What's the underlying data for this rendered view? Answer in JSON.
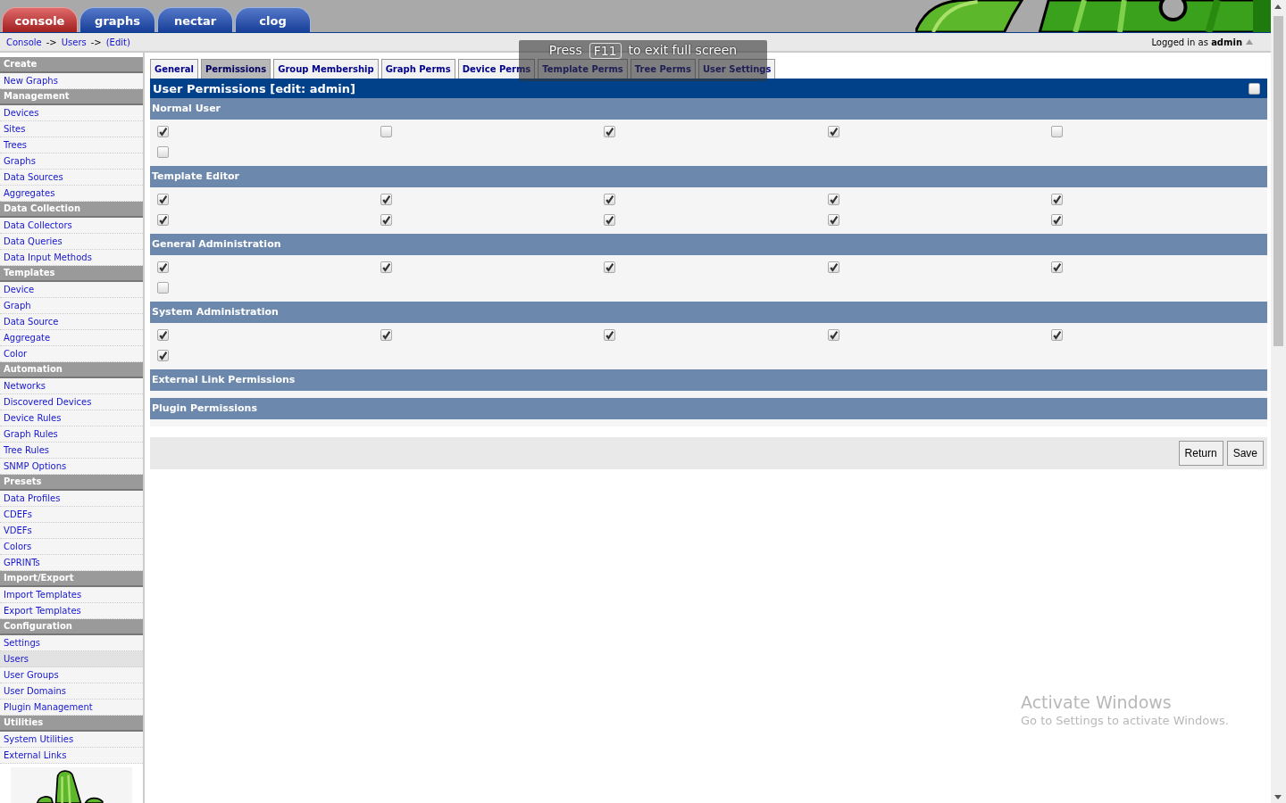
{
  "top_tabs": [
    {
      "label": "console",
      "selected": true
    },
    {
      "label": "graphs",
      "selected": false
    },
    {
      "label": "nectar",
      "selected": false
    },
    {
      "label": "clog",
      "selected": false
    }
  ],
  "breadcrumb": [
    {
      "label": "Console"
    },
    {
      "label": "Users"
    },
    {
      "label": "(Edit)"
    }
  ],
  "breadcrumb_separator": "->",
  "login": {
    "prefix": "Logged in as",
    "user": "admin"
  },
  "sidebar": [
    {
      "kind": "header",
      "label": "Create"
    },
    {
      "kind": "link",
      "label": "New Graphs",
      "selected": false
    },
    {
      "kind": "header",
      "label": "Management"
    },
    {
      "kind": "link",
      "label": "Devices",
      "selected": false
    },
    {
      "kind": "link",
      "label": "Sites",
      "selected": false
    },
    {
      "kind": "link",
      "label": "Trees",
      "selected": false
    },
    {
      "kind": "link",
      "label": "Graphs",
      "selected": false
    },
    {
      "kind": "link",
      "label": "Data Sources",
      "selected": false
    },
    {
      "kind": "link",
      "label": "Aggregates",
      "selected": false
    },
    {
      "kind": "header",
      "label": "Data Collection"
    },
    {
      "kind": "link",
      "label": "Data Collectors",
      "selected": false
    },
    {
      "kind": "link",
      "label": "Data Queries",
      "selected": false
    },
    {
      "kind": "link",
      "label": "Data Input Methods",
      "selected": false
    },
    {
      "kind": "header",
      "label": "Templates"
    },
    {
      "kind": "link",
      "label": "Device",
      "selected": false
    },
    {
      "kind": "link",
      "label": "Graph",
      "selected": false
    },
    {
      "kind": "link",
      "label": "Data Source",
      "selected": false
    },
    {
      "kind": "link",
      "label": "Aggregate",
      "selected": false
    },
    {
      "kind": "link",
      "label": "Color",
      "selected": false
    },
    {
      "kind": "header",
      "label": "Automation"
    },
    {
      "kind": "link",
      "label": "Networks",
      "selected": false
    },
    {
      "kind": "link",
      "label": "Discovered Devices",
      "selected": false
    },
    {
      "kind": "link",
      "label": "Device Rules",
      "selected": false
    },
    {
      "kind": "link",
      "label": "Graph Rules",
      "selected": false
    },
    {
      "kind": "link",
      "label": "Tree Rules",
      "selected": false
    },
    {
      "kind": "link",
      "label": "SNMP Options",
      "selected": false
    },
    {
      "kind": "header",
      "label": "Presets"
    },
    {
      "kind": "link",
      "label": "Data Profiles",
      "selected": false
    },
    {
      "kind": "link",
      "label": "CDEFs",
      "selected": false
    },
    {
      "kind": "link",
      "label": "VDEFs",
      "selected": false
    },
    {
      "kind": "link",
      "label": "Colors",
      "selected": false
    },
    {
      "kind": "link",
      "label": "GPRINTs",
      "selected": false
    },
    {
      "kind": "header",
      "label": "Import/Export"
    },
    {
      "kind": "link",
      "label": "Import Templates",
      "selected": false
    },
    {
      "kind": "link",
      "label": "Export Templates",
      "selected": false
    },
    {
      "kind": "header",
      "label": "Configuration"
    },
    {
      "kind": "link",
      "label": "Settings",
      "selected": false
    },
    {
      "kind": "link",
      "label": "Users",
      "selected": true
    },
    {
      "kind": "link",
      "label": "User Groups",
      "selected": false
    },
    {
      "kind": "link",
      "label": "User Domains",
      "selected": false
    },
    {
      "kind": "link",
      "label": "Plugin Management",
      "selected": false
    },
    {
      "kind": "header",
      "label": "Utilities"
    },
    {
      "kind": "link",
      "label": "System Utilities",
      "selected": false
    },
    {
      "kind": "link",
      "label": "External Links",
      "selected": false
    }
  ],
  "tabs": [
    {
      "label": "General",
      "selected": false
    },
    {
      "label": "Permissions",
      "selected": true
    },
    {
      "label": "Group Membership",
      "selected": false
    },
    {
      "label": "Graph Perms",
      "selected": false
    },
    {
      "label": "Device Perms",
      "selected": false
    },
    {
      "label": "Template Perms",
      "selected": false
    },
    {
      "label": "Tree Perms",
      "selected": false
    },
    {
      "label": "User Settings",
      "selected": false
    }
  ],
  "panel": {
    "title": "User Permissions [edit: admin]",
    "select_all_checked": false,
    "sections": [
      {
        "title": "Normal User",
        "boxes": [
          {
            "checked": true
          },
          {
            "checked": false
          },
          {
            "checked": true
          },
          {
            "checked": true
          },
          {
            "checked": false
          },
          {
            "checked": false
          }
        ]
      },
      {
        "title": "Template Editor",
        "boxes": [
          {
            "checked": true
          },
          {
            "checked": true
          },
          {
            "checked": true
          },
          {
            "checked": true
          },
          {
            "checked": true
          },
          {
            "checked": true
          },
          {
            "checked": true
          },
          {
            "checked": true
          },
          {
            "checked": true
          },
          {
            "checked": true
          }
        ]
      },
      {
        "title": "General Administration",
        "boxes": [
          {
            "checked": true
          },
          {
            "checked": true
          },
          {
            "checked": true
          },
          {
            "checked": true
          },
          {
            "checked": true
          },
          {
            "checked": false
          }
        ]
      },
      {
        "title": "System Administration",
        "boxes": [
          {
            "checked": true
          },
          {
            "checked": true
          },
          {
            "checked": true
          },
          {
            "checked": true
          },
          {
            "checked": true
          },
          {
            "checked": true
          }
        ]
      },
      {
        "title": "External Link Permissions"
      },
      {
        "title": "Plugin Permissions"
      }
    ]
  },
  "buttons": [
    {
      "label": "Return"
    },
    {
      "label": "Save"
    }
  ],
  "fullscreen_notice": {
    "before": "Press",
    "key": "F11",
    "after": "to exit full screen"
  },
  "windows_notice": {
    "title": "Activate Windows",
    "subtitle": "Go to Settings to activate Windows."
  }
}
